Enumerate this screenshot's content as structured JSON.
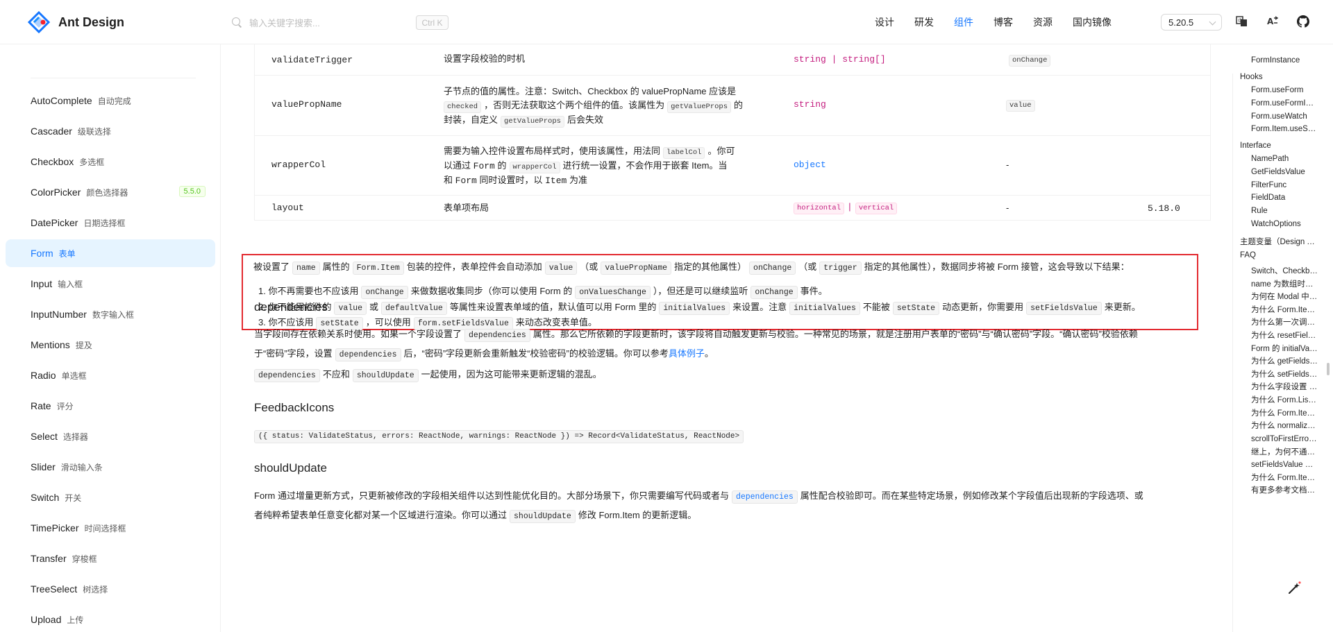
{
  "header": {
    "logo_text": "Ant Design",
    "search_placeholder": "输入关键字搜索...",
    "search_shortcut": "Ctrl K",
    "nav": [
      "设计",
      "研发",
      "组件",
      "博客",
      "资源",
      "国内镜像"
    ],
    "active_nav": "组件",
    "version": "5.20.5"
  },
  "sidebar": {
    "items": [
      {
        "en": "AutoComplete",
        "zh": "自动完成"
      },
      {
        "en": "Cascader",
        "zh": "级联选择"
      },
      {
        "en": "Checkbox",
        "zh": "多选框"
      },
      {
        "en": "ColorPicker",
        "zh": "颜色选择器",
        "badge": "5.5.0"
      },
      {
        "en": "DatePicker",
        "zh": "日期选择框"
      },
      {
        "en": "Form",
        "zh": "表单"
      },
      {
        "en": "Input",
        "zh": "输入框"
      },
      {
        "en": "InputNumber",
        "zh": "数字输入框"
      },
      {
        "en": "Mentions",
        "zh": "提及"
      },
      {
        "en": "Radio",
        "zh": "单选框"
      },
      {
        "en": "Rate",
        "zh": "评分"
      },
      {
        "en": "Select",
        "zh": "选择器"
      },
      {
        "en": "Slider",
        "zh": "滑动输入条"
      },
      {
        "en": "Switch",
        "zh": "开关"
      },
      {
        "en": "TimePicker",
        "zh": "时间选择框"
      },
      {
        "en": "Transfer",
        "zh": "穿梭框"
      },
      {
        "en": "TreeSelect",
        "zh": "树选择"
      },
      {
        "en": "Upload",
        "zh": "上传"
      }
    ],
    "active": "Form"
  },
  "table": {
    "rows": [
      {
        "name": "validateTrigger",
        "desc": "设置字段校验的时机",
        "type": "string | string[]",
        "default": "onChange"
      },
      {
        "name": "valuePropName",
        "desc_parts": [
          "子节点的值的属性。注意：Switch、Checkbox 的 valuePropName 应该是",
          "checked",
          "，否则无法获取这个两个组件的值。该属性为",
          "getValueProps",
          "的",
          "封装，自定义",
          "getValueProps",
          "后会失效"
        ],
        "type": "string",
        "default": "value"
      },
      {
        "name": "wrapperCol",
        "desc_parts": [
          "需要为输入控件设置布局样式时，使用该属性，用法同",
          "labelCol",
          "。你可",
          "以通过",
          "Form",
          "的",
          "wrapperCol",
          "进行统一设置，不会作用于嵌套 Item。当",
          "和",
          "Form",
          "同时设置时，以",
          "Item",
          "为准"
        ],
        "type": "object",
        "default": "-"
      },
      {
        "name": "layout",
        "desc": "表单项布局",
        "type_tags": [
          "horizontal",
          "vertical"
        ],
        "type_sep": "|",
        "default": "-",
        "version": "5.18.0"
      }
    ]
  },
  "note": {
    "intro": [
      "被设置了",
      "name",
      "属性的",
      "Form.Item",
      "包装的控件，表单控件会自动添加",
      "value",
      "（或",
      "valuePropName",
      "指定的其他属性）",
      "onChange",
      "（或",
      "trigger",
      "指定的其他属性），数据同步将被 Form 接管，这会导致以下结果："
    ],
    "items": [
      [
        "1.",
        "你不再需要也不应该用",
        "onChange",
        "来做数据收集同步（你可以使用 Form 的",
        "onValuesChange",
        "），但还是可以继续监听",
        "onChange",
        "事件。"
      ],
      [
        "2.",
        "你不能用控件的",
        "value",
        "或",
        "defaultValue",
        "等属性来设置表单域的值，默认值可以用 Form 里的",
        "initialValues",
        "来设置。注意",
        "initialValues",
        "不能被",
        "setState",
        "动态更新，你需要用",
        "setFieldsValue",
        "来更新。"
      ],
      [
        "3.",
        "你不应该用",
        "setState",
        "，可以使用",
        "form.setFieldsValue",
        "来动态改变表单值。"
      ]
    ]
  },
  "sections": {
    "dependencies": {
      "title": "dependencies",
      "p1": [
        "当字段间存在依赖关系时使用。如果一个字段设置了",
        "dependencies",
        "属性。那么它所依赖的字段更新时，该字段将自动触发更新与校验。一种常见的场景，就是注册用户表单的“密码”与“确认密码”字段。“确认密码”校验依赖",
        "于“密码”字段，设置",
        "dependencies",
        "后，“密码”字段更新会重新触发“校验密码”的校验逻辑。你可以参考",
        "具体例子",
        "。"
      ],
      "p2": [
        "dependencies",
        "不应和",
        "shouldUpdate",
        "一起使用，因为这可能带来更新逻辑的混乱。"
      ]
    },
    "feedback": {
      "title": "FeedbackIcons",
      "code": "({ status: ValidateStatus, errors: ReactNode, warnings: ReactNode }) => Record<ValidateStatus, ReactNode>"
    },
    "should_update": {
      "title": "shouldUpdate",
      "p1": [
        "Form 通过增量更新方式，只更新被修改的字段相关组件以达到性能优化目的。大部分场景下，你只需要编写代码或者与",
        "dependencies",
        "属性配合校验即可。而在某些特定场景，例如修改某个字段值后出现新的字段选项、或",
        "者纯粹希望表单任意变化都对某一个区域进行渲染。你可以通过",
        "shouldUpdate",
        "修改 Form.Item 的更新逻辑。"
      ]
    }
  },
  "toc": [
    {
      "label": "FormInstance",
      "level": 2
    },
    {
      "label": "Hooks",
      "level": 1
    },
    {
      "label": "Form.useForm",
      "level": 2
    },
    {
      "label": "Form.useFormInstance",
      "level": 2
    },
    {
      "label": "Form.useWatch",
      "level": 2
    },
    {
      "label": "Form.Item.useStatus",
      "level": 2
    },
    {
      "label": "Interface",
      "level": 1
    },
    {
      "label": "NamePath",
      "level": 2
    },
    {
      "label": "GetFieldsValue",
      "level": 2
    },
    {
      "label": "FilterFunc",
      "level": 2
    },
    {
      "label": "FieldData",
      "level": 2
    },
    {
      "label": "Rule",
      "level": 2
    },
    {
      "label": "WatchOptions",
      "level": 2
    },
    {
      "label": "主题变量（Design Token）",
      "level": 1
    },
    {
      "label": "FAQ",
      "level": 1
    },
    {
      "label": "Switch、Checkbox 为什么不能绑定数据？",
      "level": 2
    },
    {
      "label": "name 为数组时的转换规则？",
      "level": 2
    },
    {
      "label": "为何在 Modal 中调用 form 控制台会报错？",
      "level": 2
    },
    {
      "label": "为什么 Form.Item 下的子组件 defaultValue 不生效？",
      "level": 2
    },
    {
      "label": "为什么第一次调用 ref 的 form 为空？",
      "level": 2
    },
    {
      "label": "为什么 resetFields 会重新 mount 组件？",
      "level": 2
    },
    {
      "label": "Form 的 initialValues 与 Item 的 initialValue 区别？",
      "level": 2
    },
    {
      "label": "为什么 getFieldsValue 在初次渲染的时候拿不到值？",
      "level": 2
    },
    {
      "label": "为什么 setFieldsValue 不会触发 onFieldsChange 和 onValuesChange？",
      "level": 2
    },
    {
      "label": "为什么字段设置 rules 后更改值 onFieldsChange 会触发三次？",
      "level": 2
    },
    {
      "label": "为什么 Form.List 不支持 label 还需要使用 ErrorList 展示错误？",
      "level": 2
    },
    {
      "label": "为什么 Form.Item 的 dependencies 对 Form.List 下的字段没有效果？",
      "level": 2
    },
    {
      "label": "为什么 normalize 不能是异步方法？",
      "level": 2
    },
    {
      "label": "scrollToFirstError 和 scrollToField 失效？",
      "level": 2
    },
    {
      "label": "继上，为何不通过 ref 绑定元素？",
      "level": 2
    },
    {
      "label": "setFieldsValue 不生效？",
      "level": 2
    },
    {
      "label": "为什么 Form.Item 下使用 Space 不生效？",
      "level": 2
    },
    {
      "label": "有更多参考文档吗？",
      "level": 2
    }
  ],
  "colors": {
    "accent": "#1677ff",
    "highlight_border": "#e3292f",
    "pink": "#c41d7f"
  }
}
